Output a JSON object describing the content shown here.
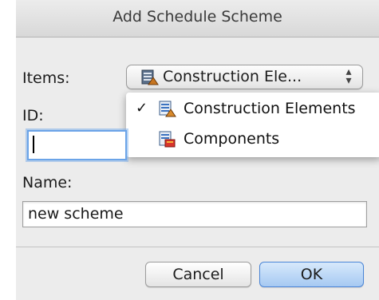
{
  "dialog": {
    "title": "Add Schedule Scheme"
  },
  "items": {
    "label": "Items:",
    "selected": "Construction Ele...",
    "arrows_icon": "updown-arrows-icon",
    "options": [
      {
        "label": "Construction Elements",
        "checked": true,
        "icon": "construction-elements-icon"
      },
      {
        "label": "Components",
        "checked": false,
        "icon": "components-icon"
      }
    ],
    "check_mark": "✓"
  },
  "id_field": {
    "label": "ID:",
    "value": ""
  },
  "name_field": {
    "label": "Name:",
    "value": "new scheme"
  },
  "buttons": {
    "cancel": "Cancel",
    "ok": "OK"
  },
  "colors": {
    "focus_ring": "#6ba4e8",
    "default_button": "#a6c9f2"
  }
}
